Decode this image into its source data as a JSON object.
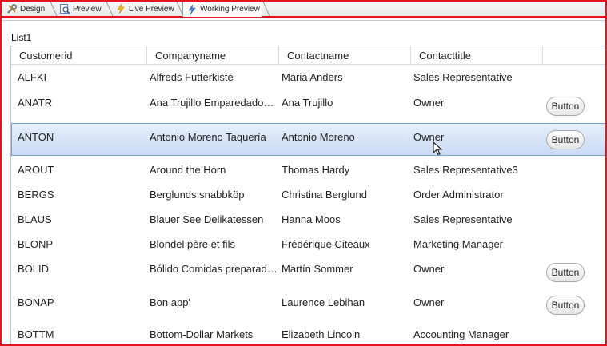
{
  "tabs": [
    {
      "label": "Design",
      "icon": "tools-icon"
    },
    {
      "label": "Preview",
      "icon": "preview-icon"
    },
    {
      "label": "Live Preview",
      "icon": "lightning-icon"
    },
    {
      "label": "Working Preview",
      "icon": "lightning-icon",
      "active": true
    }
  ],
  "list_title": "List1",
  "columns": [
    "Customerid",
    "Companyname",
    "Contactname",
    "Contacttitle"
  ],
  "rows": [
    {
      "id": "ALFKI",
      "company": "Alfreds Futterkiste",
      "contact": "Maria Anders",
      "title": "Sales Representative",
      "button": ""
    },
    {
      "id": "ANATR",
      "company": "Ana Trujillo Emparedados y helados",
      "contact": "Ana Trujillo",
      "title": "Owner",
      "button": "Button"
    },
    {
      "id": "ANTON",
      "company": "Antonio Moreno Taquería",
      "contact": "Antonio Moreno",
      "title": "Owner",
      "button": "Button",
      "selected": true
    },
    {
      "id": "AROUT",
      "company": "Around the Horn",
      "contact": "Thomas Hardy",
      "title": "Sales Representative3",
      "button": ""
    },
    {
      "id": "BERGS",
      "company": "Berglunds snabbköp",
      "contact": "Christina Berglund",
      "title": "Order Administrator",
      "button": ""
    },
    {
      "id": "BLAUS",
      "company": "Blauer See Delikatessen",
      "contact": "Hanna Moos",
      "title": "Sales Representative",
      "button": ""
    },
    {
      "id": "BLONP",
      "company": "Blondel père et fils",
      "contact": "Frédérique Citeaux",
      "title": "Marketing Manager",
      "button": ""
    },
    {
      "id": "BOLID",
      "company": "Bólido Comidas preparadas",
      "contact": "Martín Sommer",
      "title": "Owner",
      "button": "Button"
    },
    {
      "id": "BONAP",
      "company": "Bon app'",
      "contact": "Laurence Lebihan",
      "title": "Owner",
      "button": "Button"
    },
    {
      "id": "BOTTM",
      "company": "Bottom-Dollar Markets",
      "contact": "Elizabeth Lincoln",
      "title": "Accounting Manager",
      "button": ""
    }
  ],
  "colors": {
    "frame": "#e8141b",
    "selected_row": "#c9dcf5",
    "selected_border": "#7da2ce"
  }
}
